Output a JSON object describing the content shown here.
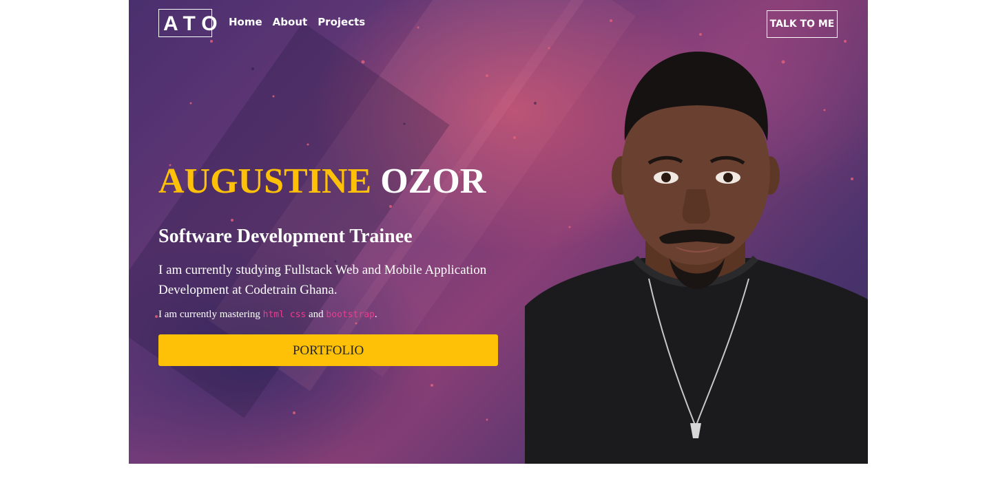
{
  "nav": {
    "logo": "ATO",
    "links": [
      "Home",
      "About",
      "Projects"
    ],
    "cta": "TALK TO ME"
  },
  "hero": {
    "first_name": "AUGUSTINE",
    "last_name": "OZOR",
    "role": "Software Development Trainee",
    "description": "I am currently studying Fullstack Web and Mobile Application Development at Codetrain Ghana.",
    "skills_prefix": "I am currently mastering ",
    "skill_1": "html css",
    "skills_and": " and ",
    "skill_2": "bootstrap",
    "skills_suffix": ".",
    "button": "PORTFOLIO"
  },
  "colors": {
    "accent": "#ffc107",
    "code": "#e83e8c",
    "bg_purple": "#4a2f6e",
    "bg_pink": "#ce5670"
  }
}
